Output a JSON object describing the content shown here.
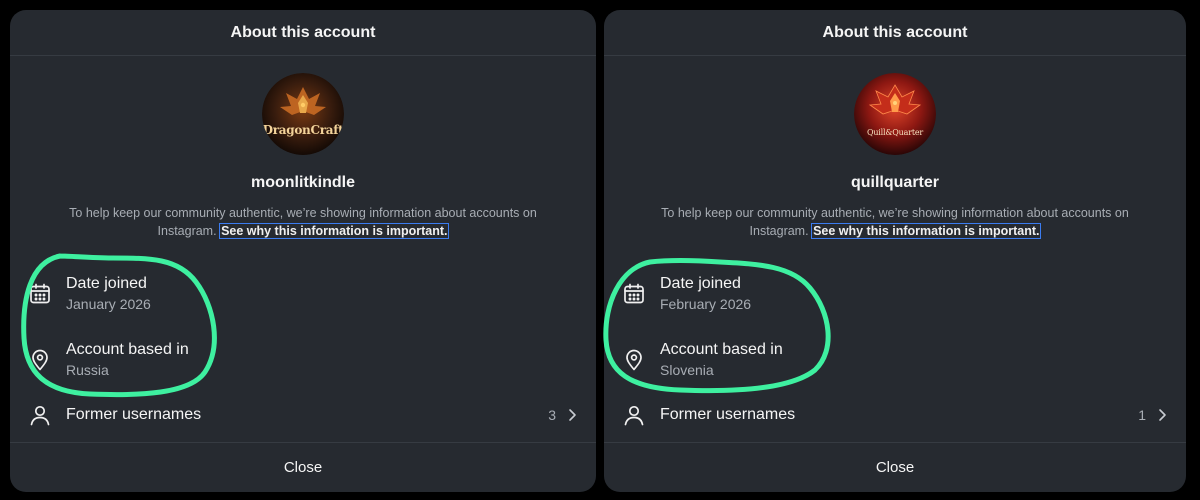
{
  "panels": [
    {
      "header_title": "About this account",
      "avatar_logo_text": "DragonCraft",
      "username": "moonlitkindle",
      "description": "To help keep our community authentic, we’re showing information about accounts on Instagram.",
      "description_link": "See why this information is important.",
      "rows": [
        {
          "title": "Date joined",
          "value": "January 2026",
          "icon": "calendar-icon"
        },
        {
          "title": "Account based in",
          "value": "Russia",
          "icon": "location-pin-icon"
        },
        {
          "title": "Former usernames",
          "count": "3",
          "icon": "user-icon"
        }
      ],
      "close_label": "Close"
    },
    {
      "header_title": "About this account",
      "avatar_logo_text": "Quill&Quarter",
      "username": "quillquarter",
      "description": "To help keep our community authentic, we’re showing information about accounts on Instagram.",
      "description_link": "See why this information is important.",
      "rows": [
        {
          "title": "Date joined",
          "value": "February 2026",
          "icon": "calendar-icon"
        },
        {
          "title": "Account based in",
          "value": "Slovenia",
          "icon": "location-pin-icon"
        },
        {
          "title": "Former usernames",
          "count": "1",
          "icon": "user-icon"
        }
      ],
      "close_label": "Close"
    }
  ],
  "colors": {
    "panel_bg": "#262a30",
    "highlight": "#3ef0a0",
    "link_outline": "#3b7cf0"
  }
}
